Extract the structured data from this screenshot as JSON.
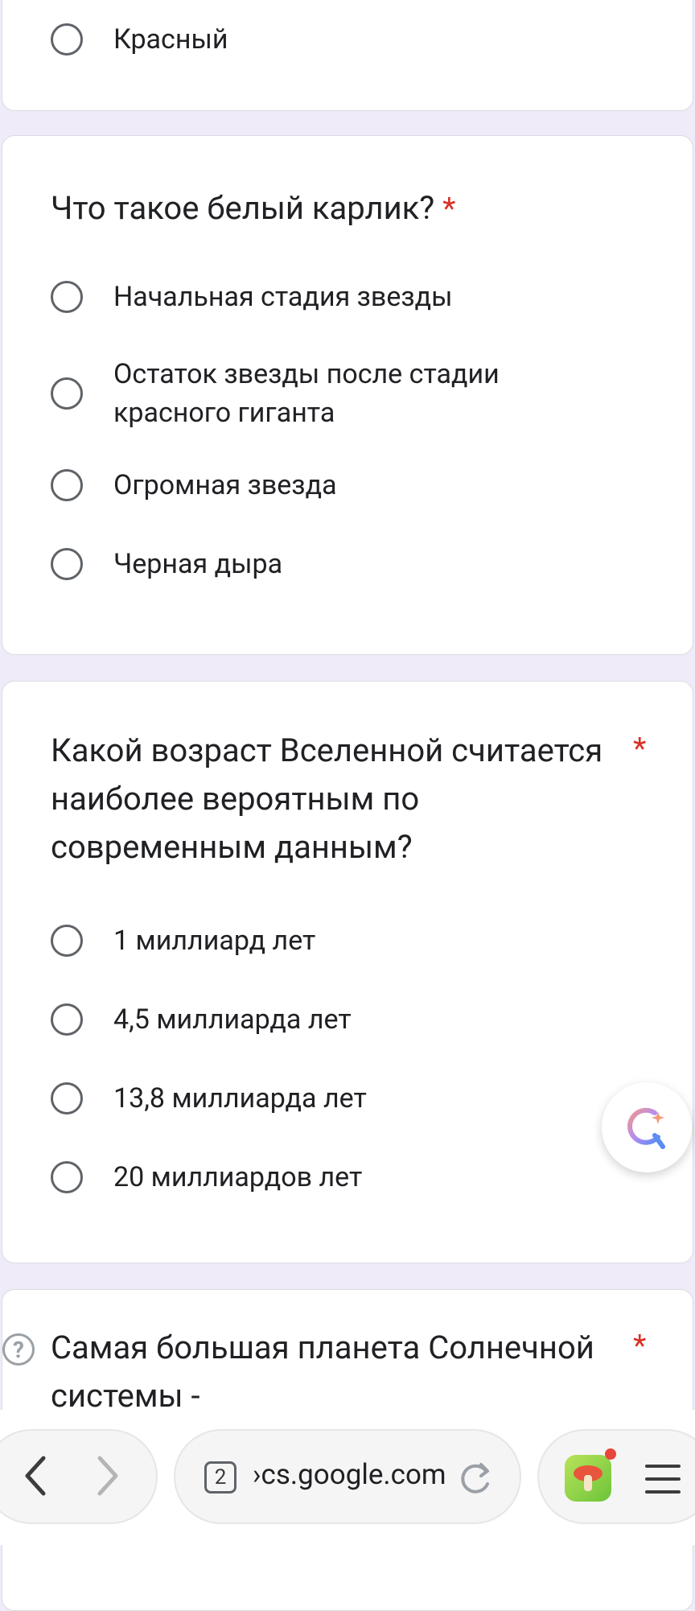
{
  "top_card": {
    "last_option": "Красный"
  },
  "q_white_dwarf": {
    "title": "Что такое белый карлик?",
    "required": "*",
    "options": [
      "Начальная стадия звезды",
      "Остаток звезды после стадии",
      "красного гиганта",
      "Огромная звезда",
      "Черная дыра"
    ]
  },
  "q_universe_age": {
    "title_lines": [
      "Какой возраст Вселенной считается",
      "наиболее вероятным по",
      "современным данным?"
    ],
    "required": "*",
    "options": [
      "1 миллиард лет",
      "4,5 миллиарда лет",
      "13,8 миллиарда лет",
      "20 миллиардов лет"
    ]
  },
  "q_largest_planet": {
    "title_lines": [
      "Самая большая планета Солнечной",
      "системы -"
    ],
    "required": "*"
  },
  "browser": {
    "tab_count": "2",
    "url": "›cs.google.com",
    "icons": [
      "back-icon",
      "forward-icon",
      "reload-icon",
      "mushroom-app-icon",
      "menu-icon",
      "ai-search-icon",
      "help-icon"
    ],
    "notification_dot_color": "#e8453c"
  }
}
